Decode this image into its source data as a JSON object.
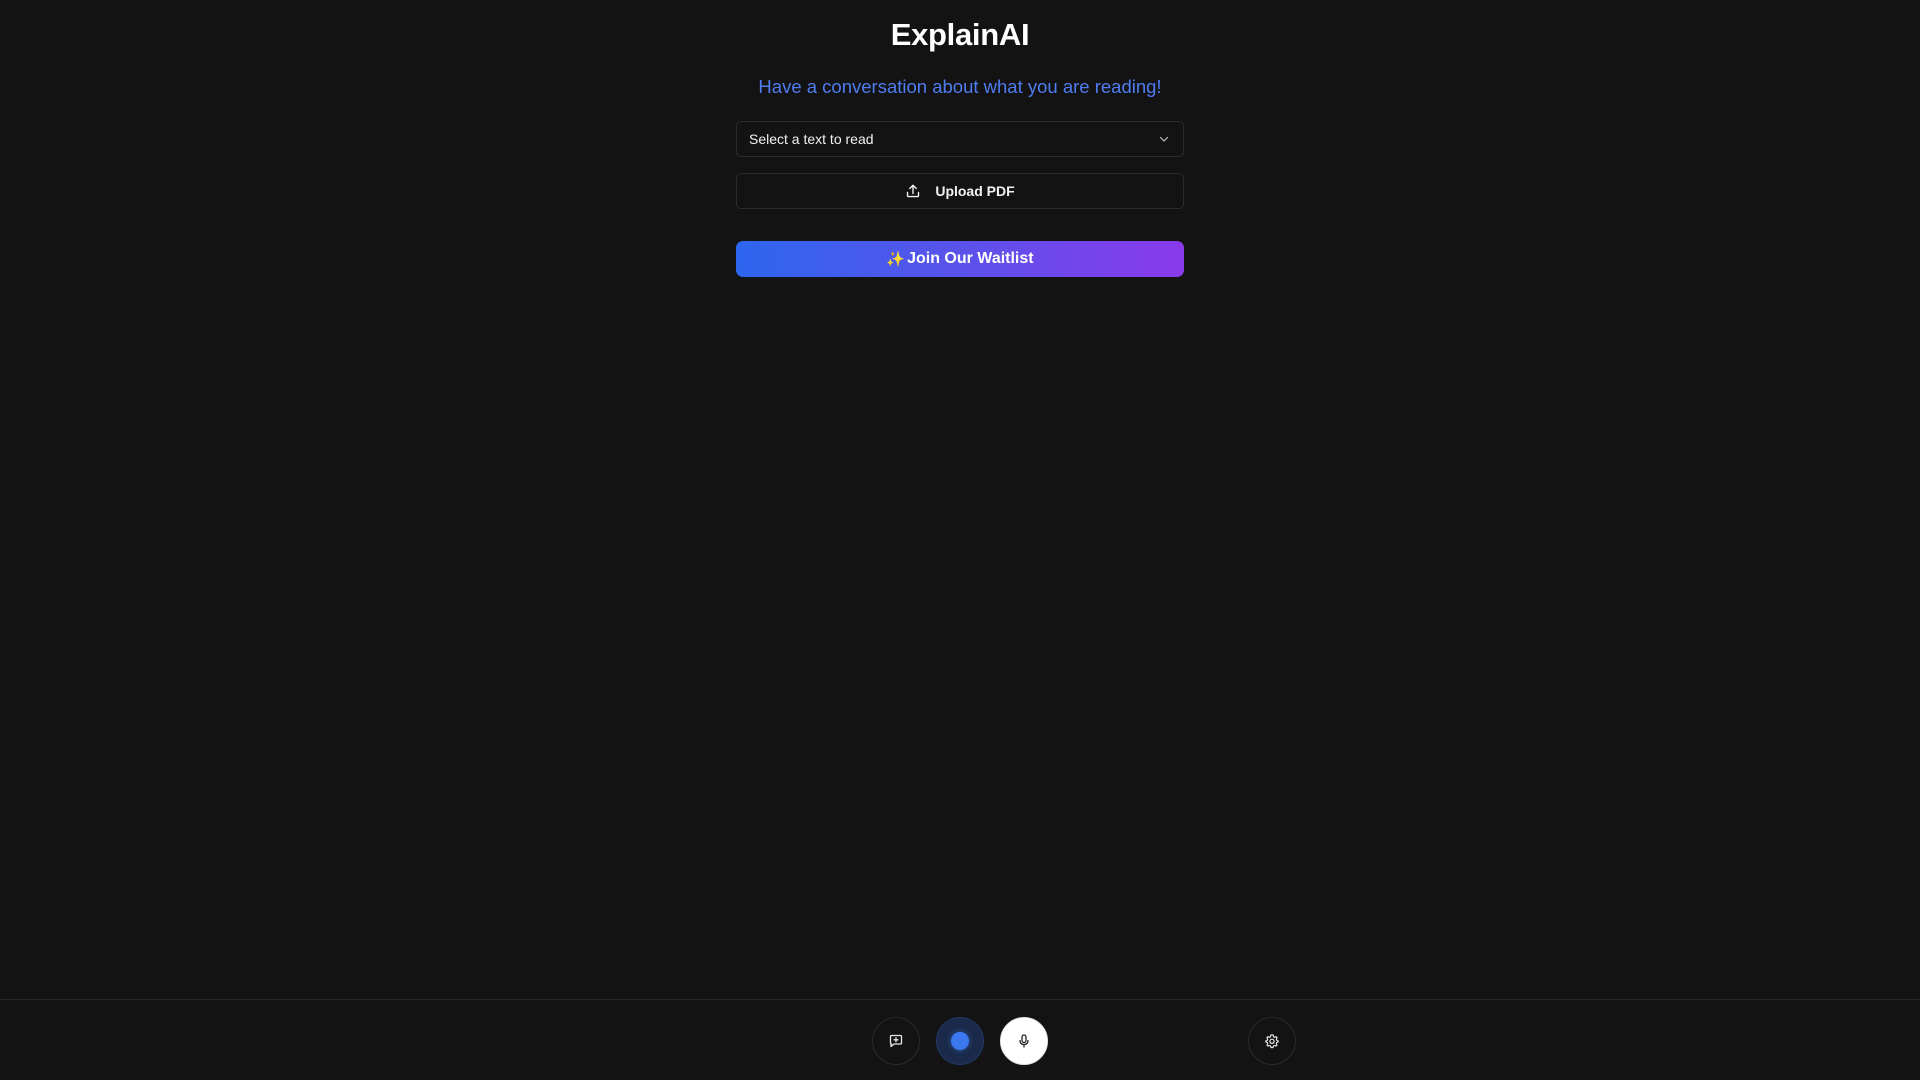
{
  "header": {
    "title": "ExplainAI",
    "subtitle": "Have a conversation about what you are reading!"
  },
  "text_select": {
    "selected_value": "Select a text to read",
    "icon": "chevron-down-icon"
  },
  "upload": {
    "label": "Upload PDF",
    "icon": "upload-icon"
  },
  "waitlist": {
    "emoji": "✨",
    "label": "Join Our Waitlist",
    "gradient_start": "#2d66ef",
    "gradient_end": "#8a3aea"
  },
  "toolbar": {
    "buttons": [
      {
        "name": "chat",
        "icon": "message-square-icon"
      },
      {
        "name": "record",
        "icon": "record-indicator-icon",
        "color": "#3b78f0"
      },
      {
        "name": "microphone",
        "icon": "microphone-icon"
      },
      {
        "name": "settings",
        "icon": "gear-icon"
      }
    ]
  },
  "colors": {
    "background": "#131314",
    "accent_text": "#4f7cf0",
    "border": "#2b2b2e"
  }
}
